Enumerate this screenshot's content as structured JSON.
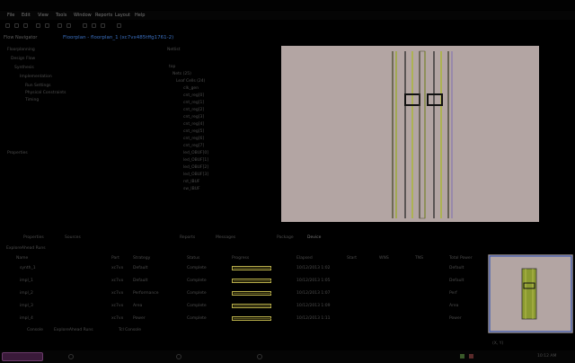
{
  "menubar": {
    "items": [
      "File",
      "Edit",
      "View",
      "Tools",
      "Window",
      "Reports",
      "Layout",
      "Help"
    ]
  },
  "tabs": {
    "project_label": "Flow Navigator",
    "path": "Floorplan - floorplan_1 (xc7vx485tffg1761-2)"
  },
  "left_panel": {
    "title": "Floorplanning",
    "items": [
      "Design Flow",
      "Synthesis",
      "Implementation",
      "Run Settings",
      "Physical Constraints",
      "Timing",
      "Properties"
    ]
  },
  "netlist_panel": {
    "title": "Netlist",
    "items": [
      "top",
      "Nets (25)",
      "Leaf Cells (24)",
      "clk_gen",
      "cnt_reg[0]",
      "cnt_reg[1]",
      "cnt_reg[2]",
      "cnt_reg[3]",
      "cnt_reg[4]",
      "cnt_reg[5]",
      "cnt_reg[6]",
      "cnt_reg[7]",
      "led_OBUF[0]",
      "led_OBUF[1]",
      "led_OBUF[2]",
      "led_OBUF[3]",
      "rst_IBUF",
      "sw_IBUF"
    ]
  },
  "bottom_tabs": {
    "left": [
      "Properties",
      "Sources"
    ],
    "mid": [
      "Reports",
      "Messages",
      "Package",
      "Device"
    ]
  },
  "runs": {
    "title": "ExploreAhead Runs",
    "columns": [
      "Name",
      "Part",
      "Strategy",
      "Status",
      "Progress",
      "Elapsed",
      "Start",
      "WNS",
      "TNS",
      "Total Power",
      "Description"
    ],
    "rows": [
      {
        "name": "synth_1",
        "part": "xc7vx",
        "strategy": "Default",
        "status": "Complete",
        "pct": 100,
        "start": "10/12/2013 1:02",
        "desc": "Default"
      },
      {
        "name": "impl_1",
        "part": "xc7vx",
        "strategy": "Default",
        "status": "Complete",
        "pct": 100,
        "start": "10/12/2013 1:05",
        "desc": "Default"
      },
      {
        "name": "impl_2",
        "part": "xc7vx",
        "strategy": "Performance",
        "status": "Complete",
        "pct": 100,
        "start": "10/12/2013 1:07",
        "desc": "Perf"
      },
      {
        "name": "impl_3",
        "part": "xc7vx",
        "strategy": "Area",
        "status": "Complete",
        "pct": 100,
        "start": "10/12/2013 1:09",
        "desc": "Area"
      },
      {
        "name": "impl_4",
        "part": "xc7vx",
        "strategy": "Power",
        "status": "Complete",
        "pct": 100,
        "start": "10/12/2013 1:11",
        "desc": "Power"
      }
    ],
    "footer_tabs": [
      "Console",
      "ExploreAhead Runs",
      "Tcl Console"
    ]
  },
  "status": {
    "coords": "(X, Y)",
    "time": "10:12 AM"
  }
}
